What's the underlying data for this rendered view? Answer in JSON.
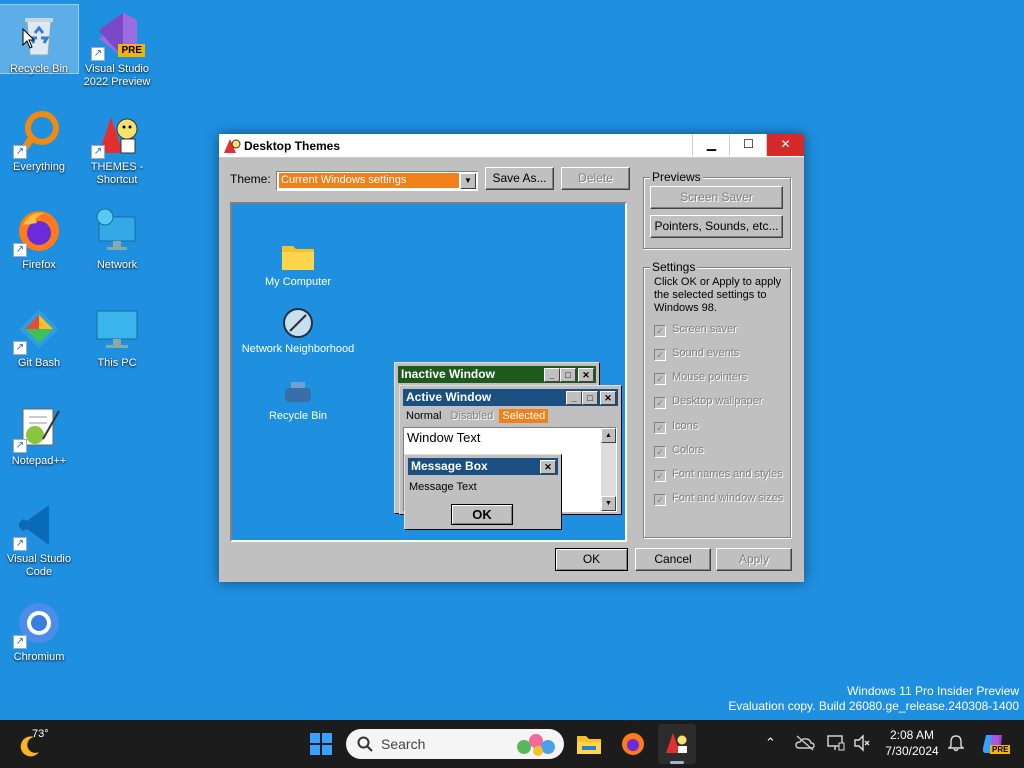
{
  "desktop": {
    "icons": [
      {
        "label": "Recycle Bin"
      },
      {
        "label": "Visual Studio 2022 Preview",
        "badge": "PRE"
      },
      {
        "label": "Everything"
      },
      {
        "label": "THEMES - Shortcut"
      },
      {
        "label": "Firefox"
      },
      {
        "label": "Network"
      },
      {
        "label": "Git Bash"
      },
      {
        "label": "This PC"
      },
      {
        "label": "Notepad++"
      },
      {
        "label": "Visual Studio Code"
      },
      {
        "label": "Chromium"
      }
    ],
    "watermark": {
      "line1": "Windows 11 Pro Insider Preview",
      "line2": "Evaluation copy. Build 26080.ge_release.240308-1400"
    }
  },
  "dialog": {
    "title": "Desktop Themes",
    "theme_label": "Theme:",
    "theme_value": "Current Windows settings",
    "save_as": "Save As...",
    "delete": "Delete",
    "preview": {
      "icons": [
        {
          "label": "My Computer"
        },
        {
          "label": "Network Neighborhood"
        },
        {
          "label": "Recycle Bin"
        }
      ],
      "inactive_title": "Inactive Window",
      "active_title": "Active Window",
      "menu": {
        "normal": "Normal",
        "disabled": "Disabled",
        "selected": "Selected"
      },
      "window_text": "Window Text",
      "message_title": "Message Box",
      "message_text": "Message Text",
      "ok": "OK"
    },
    "previews": {
      "label": "Previews",
      "screen_saver": "Screen Saver",
      "pointers": "Pointers, Sounds, etc..."
    },
    "settings": {
      "label": "Settings",
      "desc": "Click OK or Apply to apply the selected settings to Windows 98.",
      "items": [
        "Screen saver",
        "Sound events",
        "Mouse pointers",
        "Desktop wallpaper",
        "Icons",
        "Colors",
        "Font names and styles",
        "Font and window sizes"
      ]
    },
    "ok": "OK",
    "cancel": "Cancel",
    "apply": "Apply"
  },
  "taskbar": {
    "weather": "73°",
    "search_placeholder": "Search",
    "time": "2:08 AM",
    "date": "7/30/2024",
    "copilot_badge": "PRE"
  },
  "colors": {
    "desktop": "#1f8fe0",
    "inactive_title": "#1e5a1e",
    "active_title": "#1b4f82",
    "selected": "#f0801a"
  }
}
